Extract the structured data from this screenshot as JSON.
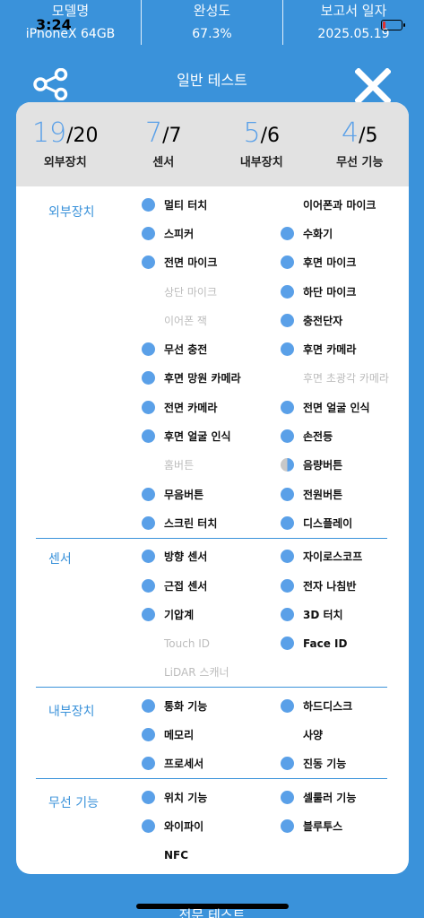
{
  "top_info": {
    "model_label": "모델명",
    "model_value": "iPhoneX 64GB",
    "completion_label": "완성도",
    "completion_value": "67.3%",
    "report_label": "보고서 일자",
    "report_value": "2025.05.19"
  },
  "status_bar": {
    "time": "3:24",
    "battery_level": 0.15
  },
  "header": {
    "title": "일반 테스트",
    "share_icon": "share-icon",
    "close_icon": "close-icon"
  },
  "summary": [
    {
      "done": "19",
      "total": "/20",
      "label": "외부장치"
    },
    {
      "done": "7",
      "total": "/7",
      "label": "센서"
    },
    {
      "done": "5",
      "total": "/6",
      "label": "내부장치"
    },
    {
      "done": "4",
      "total": "/5",
      "label": "무선 기능"
    }
  ],
  "sections": [
    {
      "title": "외부장치",
      "items": [
        {
          "label": "멀티 터치",
          "state": "on"
        },
        {
          "label": "이어폰과 마이크",
          "state": "none"
        },
        {
          "label": "스피커",
          "state": "on"
        },
        {
          "label": "수화기",
          "state": "on"
        },
        {
          "label": "전면 마이크",
          "state": "on"
        },
        {
          "label": "후면 마이크",
          "state": "on"
        },
        {
          "label": "상단 마이크",
          "state": "off"
        },
        {
          "label": "하단 마이크",
          "state": "on"
        },
        {
          "label": "이어폰 잭",
          "state": "off"
        },
        {
          "label": "충전단자",
          "state": "on"
        },
        {
          "label": "무선 충전",
          "state": "on"
        },
        {
          "label": "후면 카메라",
          "state": "on"
        },
        {
          "label": "후면 망원 카메라",
          "state": "on"
        },
        {
          "label": "후면 초광각 카메라",
          "state": "off"
        },
        {
          "label": "전면 카메라",
          "state": "on"
        },
        {
          "label": "전면 얼굴 인식",
          "state": "on"
        },
        {
          "label": "후면 얼굴 인식",
          "state": "on"
        },
        {
          "label": "손전등",
          "state": "on"
        },
        {
          "label": "홈버튼",
          "state": "off"
        },
        {
          "label": "음량버튼",
          "state": "half"
        },
        {
          "label": "무음버튼",
          "state": "on"
        },
        {
          "label": "전원버튼",
          "state": "on"
        },
        {
          "label": "스크린 터치",
          "state": "on"
        },
        {
          "label": "디스플레이",
          "state": "on"
        }
      ]
    },
    {
      "title": "센서",
      "items": [
        {
          "label": "방향 센서",
          "state": "on"
        },
        {
          "label": "자이로스코프",
          "state": "on"
        },
        {
          "label": "근접 센서",
          "state": "on"
        },
        {
          "label": "전자 나침반",
          "state": "on"
        },
        {
          "label": "기압계",
          "state": "on"
        },
        {
          "label": "3D 터치",
          "state": "on"
        },
        {
          "label": "Touch ID",
          "state": "off"
        },
        {
          "label": "Face ID",
          "state": "on"
        },
        {
          "label": "LiDAR 스캐너",
          "state": "off"
        }
      ]
    },
    {
      "title": "내부장치",
      "items": [
        {
          "label": "통화 기능",
          "state": "on"
        },
        {
          "label": "하드디스크",
          "state": "on"
        },
        {
          "label": "메모리",
          "state": "on"
        },
        {
          "label": "사양",
          "state": "none"
        },
        {
          "label": "프로세서",
          "state": "on"
        },
        {
          "label": "진동 기능",
          "state": "on"
        }
      ]
    },
    {
      "title": "무선 기능",
      "items": [
        {
          "label": "위치 기능",
          "state": "on"
        },
        {
          "label": "셀룰러 기능",
          "state": "on"
        },
        {
          "label": "와이파이",
          "state": "on"
        },
        {
          "label": "블루투스",
          "state": "on"
        },
        {
          "label": "NFC",
          "state": "none"
        }
      ]
    }
  ],
  "bottom": {
    "label": "전문 테스트"
  },
  "colors": {
    "background": "#3a92da",
    "accent": "#5aa0e8",
    "summary_bg": "#e2e2e2",
    "inactive_text": "#bcbcbc"
  }
}
